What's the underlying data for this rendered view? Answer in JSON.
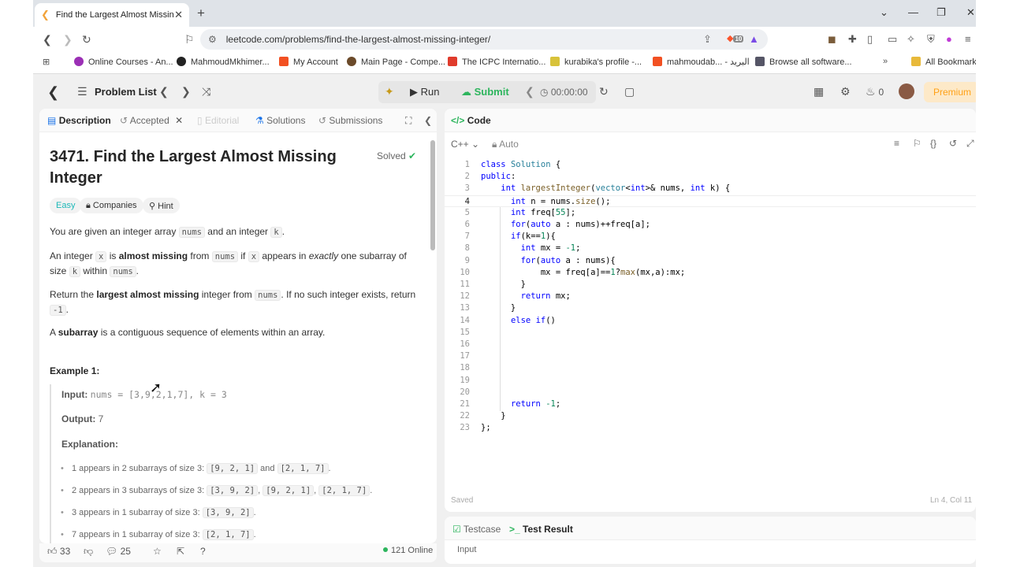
{
  "browser": {
    "tab_title": "Find the Largest Almost Missing",
    "url": "leetcode.com/problems/find-the-largest-almost-missing-integer/",
    "extension_badge": "10",
    "bookmarks": [
      "Online Courses - An...",
      "MahmoudMkhimer...",
      "My Account",
      "Main Page - Compe...",
      "The ICPC Internatio...",
      "kurabika's profile -...",
      "mahmoudab... - البريد",
      "Browse all software...",
      "All Bookmarks"
    ]
  },
  "header": {
    "problem_list": "Problem List",
    "run": "Run",
    "submit": "Submit",
    "timer": "00:00:00",
    "streak": "0",
    "premium": "Premium"
  },
  "left_tabs": {
    "description": "Description",
    "accepted": "Accepted",
    "editorial": "Editorial",
    "solutions": "Solutions",
    "submissions": "Submissions"
  },
  "problem": {
    "title": "3471. Find the Largest Almost Missing Integer",
    "solved": "Solved",
    "tags": [
      "Easy",
      "Companies",
      "Hint"
    ],
    "p1": [
      "You are given an integer array ",
      "nums",
      " and an integer ",
      "k",
      "."
    ],
    "p2": [
      "An integer ",
      "x",
      " is ",
      "almost missing",
      " from ",
      "nums",
      " if ",
      "x",
      " appears in ",
      "exactly",
      " one subarray of size ",
      "k",
      " within ",
      "nums",
      "."
    ],
    "p3": [
      "Return the ",
      "largest almost missing",
      " integer from ",
      "nums",
      ". If no such integer exists, return ",
      "-1",
      "."
    ],
    "p4": [
      "A ",
      "subarray",
      " is a contiguous sequence of elements within an array."
    ],
    "example_heading": "Example 1:",
    "input_label": "Input:",
    "input_value": "nums = [3,9,2,1,7], k = 3",
    "output_label": "Output:",
    "output_value": "7",
    "explanation_label": "Explanation:",
    "bullets": [
      {
        "text": "1 appears in 2 subarrays of size 3: ",
        "codes": [
          "[9, 2, 1]",
          " and ",
          "[2, 1, 7]",
          "."
        ]
      },
      {
        "text": "2 appears in 3 subarrays of size 3: ",
        "codes": [
          "[3, 9, 2]",
          ", ",
          "[9, 2, 1]",
          ", ",
          "[2, 1, 7]",
          "."
        ]
      },
      {
        "text": "3 appears in 1 subarray of size 3: ",
        "codes": [
          "[3, 9, 2]",
          "."
        ]
      },
      {
        "text": "7 appears in 1 subarray of size 3: ",
        "codes": [
          "[2, 1, 7]",
          "."
        ]
      }
    ]
  },
  "bottom_bar": {
    "likes": "33",
    "comments": "25",
    "online": "121 Online"
  },
  "editor": {
    "tab": "Code",
    "language": "C++",
    "mode": "Auto",
    "saved": "Saved",
    "position": "Ln 4, Col 11",
    "lines": [
      "class Solution {",
      "public:",
      "    int largestInteger(vector<int>& nums, int k) {",
      "      int n = nums.size();",
      "      int freq[55];",
      "      for(auto a : nums)++freq[a];",
      "      if(k==1){",
      "        int mx = -1;",
      "        for(auto a : nums){",
      "            mx = freq[a]==1?max(mx,a):mx;",
      "        }",
      "        return mx;",
      "      }",
      "      else if()",
      "",
      "",
      "",
      "",
      "",
      "",
      "      return -1;",
      "    }",
      "};"
    ]
  },
  "test_panel": {
    "testcase": "Testcase",
    "test_result": "Test Result",
    "input_label": "Input"
  },
  "colors": {
    "accent_green": "#2db55d",
    "premium_orange": "#ffa116",
    "easy_teal": "#1cb8b8"
  }
}
